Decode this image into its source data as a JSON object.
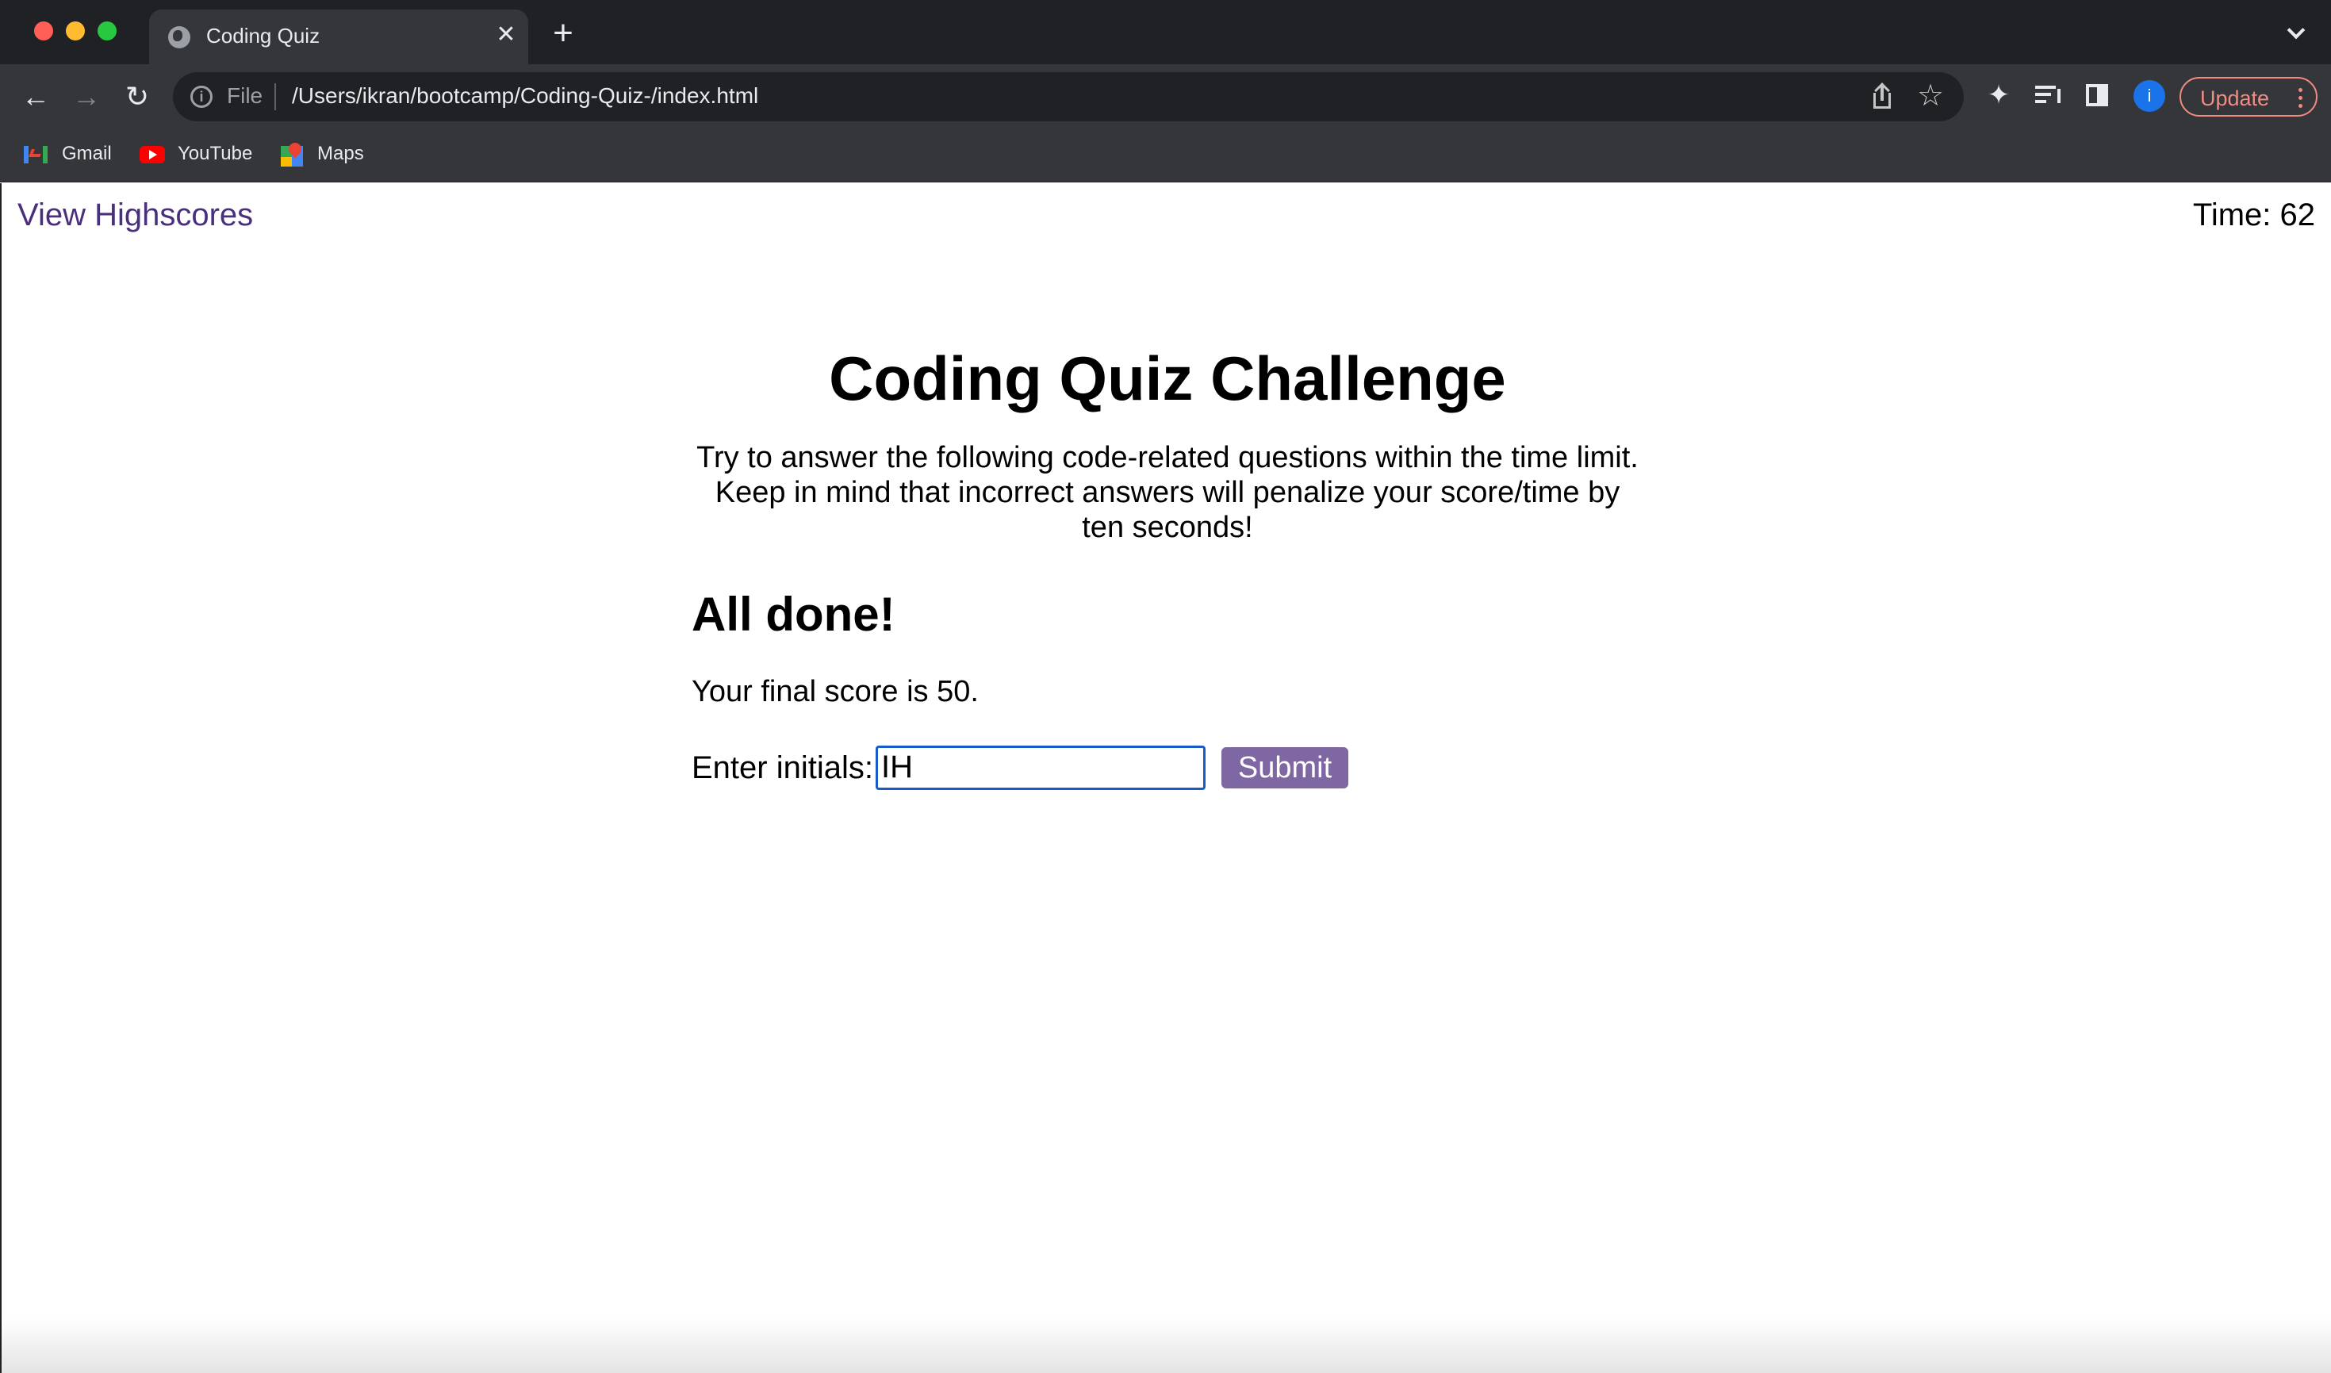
{
  "browser": {
    "tab": {
      "title": "Coding Quiz",
      "close_symbol": "✕",
      "icon": "globe-icon"
    },
    "new_tab_symbol": "+",
    "nav": {
      "back_symbol": "←",
      "forward_symbol": "→",
      "reload_symbol": "↻"
    },
    "omnibox": {
      "scheme_label": "File",
      "url": "/Users/ikran/bootcamp/Coding-Quiz-/index.html"
    },
    "profile_initial": "i",
    "update_label": "Update",
    "bookmarks": [
      {
        "label": "Gmail",
        "icon": "gmail-icon"
      },
      {
        "label": "YouTube",
        "icon": "youtube-icon"
      },
      {
        "label": "Maps",
        "icon": "maps-icon"
      }
    ],
    "colors": {
      "frame": "#202124",
      "toolbar": "#35363a",
      "update_accent": "#f28b82",
      "profile": "#1a73e8"
    }
  },
  "page": {
    "highscores_link": "View Highscores",
    "timer": "Time: 62",
    "title": "Coding Quiz Challenge",
    "intro": "Try to answer the following code-related questions within the time limit. Keep in mind that incorrect answers will penalize your score/time by ten seconds!",
    "done_heading": "All done!",
    "final_score_text": "Your final score is 50.",
    "initials_label": "Enter initials:",
    "initials_value": "IH",
    "submit_label": "Submit",
    "colors": {
      "link": "#4b2f7f",
      "submit_button": "#7e67a3",
      "input_focus": "#1a5cc7"
    }
  }
}
